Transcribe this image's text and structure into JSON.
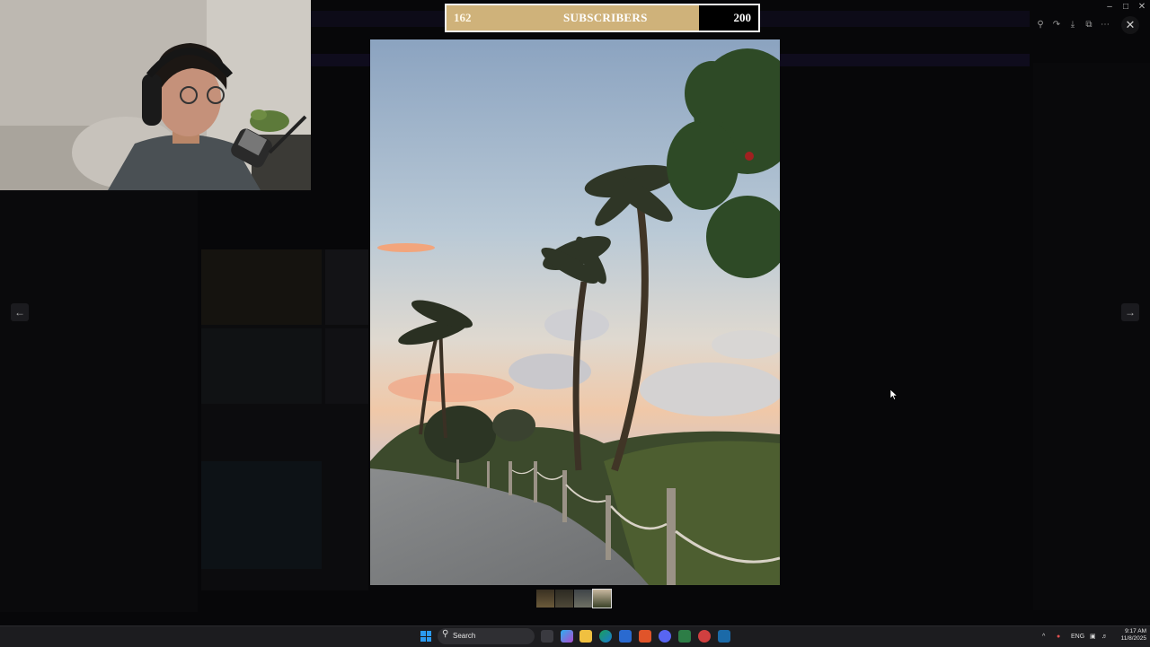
{
  "subscriber_goal": {
    "current": "162",
    "label": "SUBSCRIBERS",
    "goal": "200",
    "progress": 0.81
  },
  "viewer": {
    "toolbar_icons": [
      "zoom-icon",
      "share-icon",
      "download-icon",
      "open-external-icon",
      "more-icon"
    ],
    "close_icon": "close-icon",
    "prev_icon": "arrow-left-icon",
    "next_icon": "arrow-right-icon",
    "thumbnail_count": 4,
    "selected_thumbnail": 4
  },
  "window_controls": [
    "minimize-icon",
    "maximize-icon",
    "close-icon"
  ],
  "taskbar": {
    "search_label": "Search",
    "language": "ENG",
    "time": "9:17 AM",
    "date": "11/8/2025"
  },
  "colors": {
    "goal_fill": "#cfb27a",
    "accent_blue": "#2b9af0"
  }
}
